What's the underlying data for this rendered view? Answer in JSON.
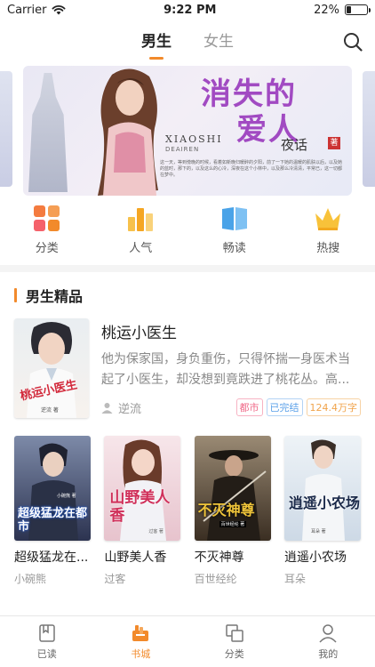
{
  "status": {
    "carrier": "Carrier",
    "time": "9:22 PM",
    "battery_text": "22%",
    "battery_level": 0.22
  },
  "top_tabs": [
    {
      "label": "男生",
      "active": true
    },
    {
      "label": "女生",
      "active": false
    }
  ],
  "banner": {
    "title_line1": "消失的",
    "title_line2": "爱人",
    "brand": "XIAOSHI",
    "brand_sub": "DEAIREN",
    "author": "夜话",
    "seal": "著",
    "blurb": "这一天，等到傍晚的时候，看着如新晚归暖醉的夕阳，前了一下她的温暖的肌肤以后，以及她的蓝时，那下的，以及这么的心冷，深夜在这个小林中，以及那么冷清清，平常已，这一切都在梦中。"
  },
  "quick_nav": [
    {
      "label": "分类",
      "icon": "grid-icon"
    },
    {
      "label": "人气",
      "icon": "bar-chart-icon"
    },
    {
      "label": "畅读",
      "icon": "book-open-icon"
    },
    {
      "label": "热搜",
      "icon": "crown-icon"
    }
  ],
  "section": {
    "title": "男生精品"
  },
  "featured": {
    "title": "桃运小医生",
    "description": "他为保家国，身负重伤，只得怀揣一身医术当起了小医生，却没想到竟跌进了桃花丛。高...",
    "author": "逆流",
    "tags": [
      {
        "label": "都市",
        "color": "#f06c8a"
      },
      {
        "label": "已完结",
        "color": "#5aa0e8"
      },
      {
        "label": "124.4万字",
        "color": "#f0a34a"
      }
    ],
    "cover_title": "桃运小医生",
    "cover_author": "逆流 著"
  },
  "books": [
    {
      "title": "超级猛龙在...",
      "author": "小碗熊",
      "cover_text": "超级猛龙在都市",
      "cover_author": "小碗熊 著",
      "bg1": "#7d8aa8",
      "bg2": "#2c3350",
      "text_color": "#1f4fb5"
    },
    {
      "title": "山野美人香",
      "author": "过客",
      "cover_text": "山野美人香",
      "cover_author": "过客 著",
      "bg1": "#f7e6ea",
      "bg2": "#e7c3cd",
      "text_color": "#d0305a"
    },
    {
      "title": "不灭神尊",
      "author": "百世经纶",
      "cover_text": "不灭神尊",
      "cover_author": "百世经纶 著",
      "bg1": "#9a8a74",
      "bg2": "#3a2e22",
      "text_color": "#f0c53a"
    },
    {
      "title": "逍遥小农场",
      "author": "耳朵",
      "cover_text": "逍遥小农场",
      "cover_author": "耳朵 著",
      "bg1": "#eef3f7",
      "bg2": "#cdd9e6",
      "text_color": "#1b2a4a"
    }
  ],
  "bottom_nav": [
    {
      "label": "已读",
      "icon": "bookmark-icon",
      "active": false
    },
    {
      "label": "书城",
      "icon": "bookstore-icon",
      "active": true
    },
    {
      "label": "分类",
      "icon": "category-icon",
      "active": false
    },
    {
      "label": "我的",
      "icon": "profile-icon",
      "active": false
    }
  ],
  "colors": {
    "accent": "#f28a2b"
  }
}
